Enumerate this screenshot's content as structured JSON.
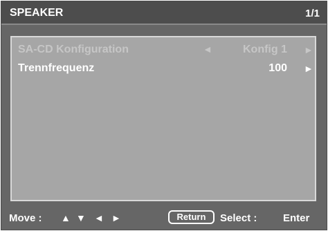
{
  "header": {
    "title": "SPEAKER",
    "page": "1/1"
  },
  "menu": {
    "items": [
      {
        "label": "SA-CD Konfiguration",
        "value": "Konfig 1",
        "left_arrow": "◄",
        "right_arrow": "►",
        "state": "disabled"
      },
      {
        "label": "Trennfrequenz",
        "value": "100",
        "right_arrow": "►",
        "state": "enabled"
      }
    ]
  },
  "footer": {
    "move_label": "Move :",
    "move_arrows": {
      "up": "▲",
      "down": "▼",
      "left": "◄",
      "right": "►"
    },
    "return_label": "Return",
    "select_label": "Select :",
    "enter_label": "Enter"
  },
  "colors": {
    "screen_background": "#666666",
    "header_background": "#4d4d4d",
    "panel_background": "#a6a6a6",
    "panel_border": "#d9d9d9",
    "enabled_text": "#ffffff",
    "disabled_text": "#c6c6c6"
  },
  "icons": {
    "move_up": "arrow-up-icon",
    "move_down": "arrow-down-icon",
    "move_left": "arrow-left-icon",
    "move_right": "arrow-right-icon"
  }
}
